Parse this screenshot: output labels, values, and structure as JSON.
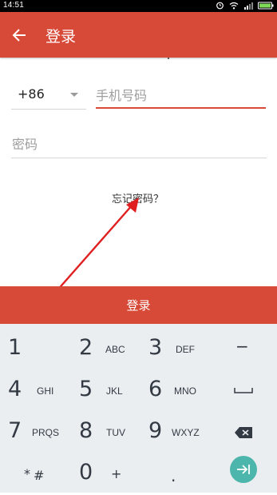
{
  "status_bar": {
    "time": "14:51",
    "icons": [
      "alarm-icon",
      "wifi-icon",
      "signal-icon",
      "battery-icon"
    ]
  },
  "app_bar": {
    "title": "登录",
    "back_icon": "arrow-left-icon",
    "color": "#d84a38"
  },
  "form": {
    "country_code": "+86",
    "phone_placeholder": "手机号码",
    "password_placeholder": "密码",
    "forgot_password": "忘记密码？",
    "login_button": "登录",
    "accent_color": "#d84a38"
  },
  "keyboard": {
    "rows": [
      [
        {
          "digit": "1",
          "letters": ""
        },
        {
          "digit": "2",
          "letters": "ABC"
        },
        {
          "digit": "3",
          "letters": "DEF"
        },
        {
          "symbol": "−"
        }
      ],
      [
        {
          "digit": "4",
          "letters": "GHI"
        },
        {
          "digit": "5",
          "letters": "JKL"
        },
        {
          "digit": "6",
          "letters": "MNO"
        },
        {
          "symbol": "space-icon"
        }
      ],
      [
        {
          "digit": "7",
          "letters": "PRQS"
        },
        {
          "digit": "8",
          "letters": "TUV"
        },
        {
          "digit": "9",
          "letters": "WXYZ"
        },
        {
          "symbol": "backspace-icon"
        }
      ],
      [
        {
          "symbol": "*#"
        },
        {
          "digit": "0",
          "letters": "+"
        },
        {
          "symbol": "."
        },
        {
          "symbol": "enter-icon"
        }
      ]
    ],
    "r1": {
      "k1": "1",
      "k2": "2",
      "k2l": "ABC",
      "k3": "3",
      "k3l": "DEF",
      "k4": "−"
    },
    "r2": {
      "k1": "4",
      "k1l": "GHI",
      "k2": "5",
      "k2l": "JKL",
      "k3": "6",
      "k3l": "MNO"
    },
    "r3": {
      "k1": "7",
      "k1l": "PRQS",
      "k2": "8",
      "k2l": "TUV",
      "k3": "9",
      "k3l": "WXYZ"
    },
    "r4": {
      "k1": "*",
      "k1b": "#",
      "k2": "0",
      "k2l": "+",
      "k3": "."
    },
    "enter_color": "#4db6ac"
  }
}
